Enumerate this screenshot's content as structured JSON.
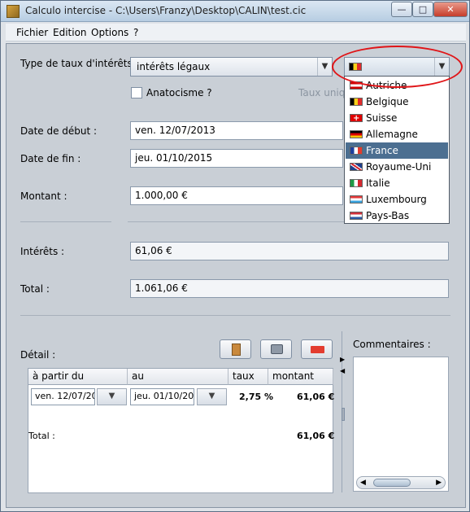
{
  "window": {
    "title": "Calculo intercise - C:\\Users\\Franzy\\Desktop\\CALIN\\test.cic"
  },
  "menubar": {
    "items": [
      "Fichier",
      "Edition",
      "Options",
      "?"
    ]
  },
  "form": {
    "type_label": "Type de taux d'intérêts :",
    "type_value": "intérêts légaux",
    "anatocisme_label": "Anatocisme ?",
    "taux_partial_label": "Taux uniqu",
    "start_label": "Date de début :",
    "start_value": "ven. 12/07/2013",
    "end_label": "Date de fin :",
    "end_value": "jeu. 01/10/2015",
    "amount_label": "Montant :",
    "amount_value": "1.000,00 €",
    "interest_label": "Intérêts :",
    "interest_value": "61,06 €",
    "total_label": "Total :",
    "total_value": "1.061,06 €"
  },
  "country_combo": {
    "selected_flag": "belgium-flag",
    "arrow": "▼"
  },
  "country_dropdown": {
    "items": [
      {
        "label": "Autriche",
        "flag": "austria-flag",
        "colors": [
          "#d00000",
          "#ffffff",
          "#d00000"
        ]
      },
      {
        "label": "Belgique",
        "flag": "belgium-flag",
        "colors": [
          "#000000",
          "#f7d21b",
          "#e22b2b"
        ]
      },
      {
        "label": "Suisse",
        "flag": "switzerland-flag",
        "colors": [
          "#e00000",
          "#ffffff"
        ]
      },
      {
        "label": "Allemagne",
        "flag": "germany-flag",
        "colors": [
          "#000000",
          "#dd0000",
          "#f7c500"
        ]
      },
      {
        "label": "France",
        "flag": "france-flag",
        "colors": [
          "#1d3f9e",
          "#ffffff",
          "#e43a2e"
        ],
        "selected": true
      },
      {
        "label": "Royaume-Uni",
        "flag": "uk-flag",
        "colors": [
          "#1f3e8a",
          "#ffffff",
          "#d4252f"
        ]
      },
      {
        "label": "Italie",
        "flag": "italy-flag",
        "colors": [
          "#1f9a45",
          "#ffffff",
          "#d5282f"
        ]
      },
      {
        "label": "Luxembourg",
        "flag": "luxembourg-flag",
        "colors": [
          "#e5393a",
          "#ffffff",
          "#39a3df"
        ]
      },
      {
        "label": "Pays-Bas",
        "flag": "netherlands-flag",
        "colors": [
          "#d1303a",
          "#ffffff",
          "#2a5aa5"
        ]
      }
    ]
  },
  "detail": {
    "label": "Détail :",
    "columns": [
      "à partir du",
      "au",
      "taux",
      "montant"
    ],
    "row": {
      "from": "ven. 12/07/20",
      "to": "jeu. 01/10/20",
      "rate": "2,75 %",
      "amount": "61,06 €"
    },
    "total_label": "Total :",
    "total_value": "61,06 €"
  },
  "comments": {
    "label": "Commentaires :"
  }
}
